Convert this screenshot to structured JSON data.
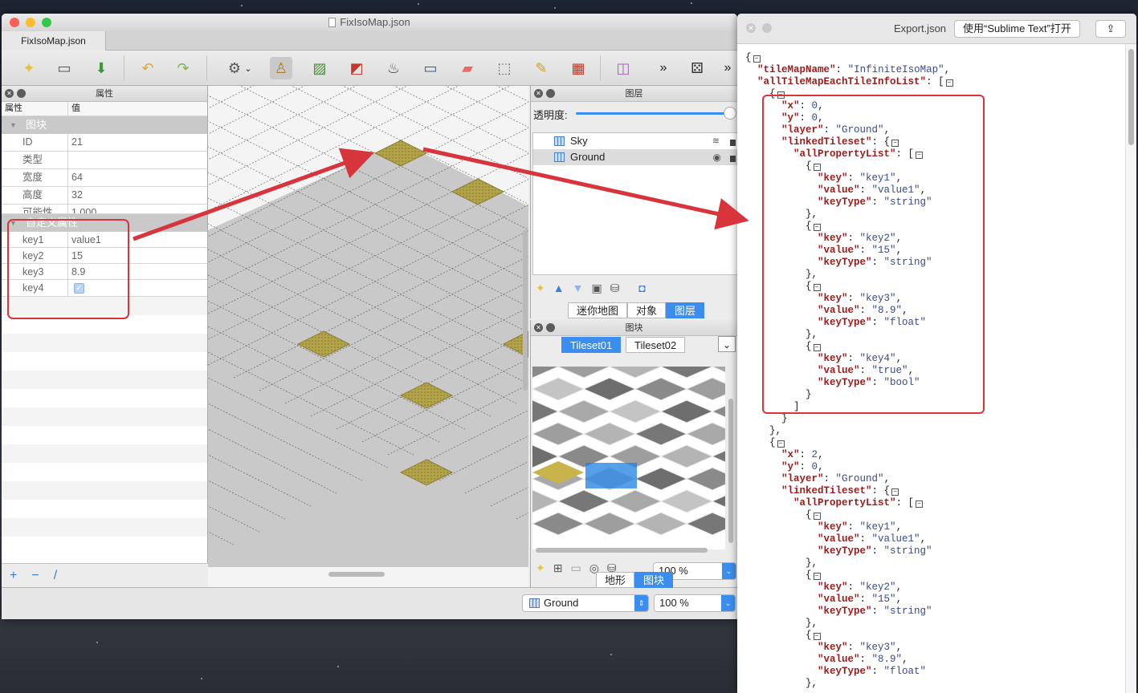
{
  "tiled": {
    "window_title": "FixIsoMap.json",
    "tab_label": "FixIsoMap.json",
    "properties_panel": {
      "title": "属性",
      "col_property": "属性",
      "col_value": "值",
      "group_tile": "图块",
      "rows": [
        {
          "key": "ID",
          "value": "21"
        },
        {
          "key": "类型",
          "value": ""
        },
        {
          "key": "宽度",
          "value": "64"
        },
        {
          "key": "高度",
          "value": "32"
        },
        {
          "key": "可能性",
          "value": "1.000"
        }
      ],
      "group_custom": "自定义属性",
      "custom_rows": [
        {
          "key": "key1",
          "value": "value1"
        },
        {
          "key": "key2",
          "value": "15"
        },
        {
          "key": "key3",
          "value": "8.9"
        },
        {
          "key": "key4",
          "value": "true"
        }
      ],
      "footer_buttons": [
        "+",
        "−",
        "/"
      ]
    },
    "layers_panel": {
      "title": "图层",
      "opacity_label": "透明度:",
      "layers": [
        {
          "name": "Sky"
        },
        {
          "name": "Ground"
        }
      ],
      "tabs": [
        "迷你地图",
        "对象",
        "图层"
      ],
      "active_tab": "图层"
    },
    "tileset_panel": {
      "title": "图块",
      "tabs": [
        "Tileset01",
        "Tileset02"
      ],
      "active_tab": "Tileset01",
      "zoom": "100 %",
      "bottom_tabs": [
        "地形",
        "图块"
      ],
      "active_bottom_tab": "图块"
    },
    "status": {
      "layer_select": "Ground",
      "zoom": "100 %"
    }
  },
  "export": {
    "title": "Export.json",
    "open_button": "使用“Sublime Text”打开",
    "json_lines": [
      "{",
      "  \"tileMapName\": \"InfiniteIsoMap\",",
      "  \"allTileMapEachTileInfoList\": [",
      "    {",
      "      \"x\": 0,",
      "      \"y\": 0,",
      "      \"layer\": \"Ground\",",
      "      \"linkedTileset\": {",
      "        \"allPropertyList\": [",
      "          {",
      "            \"key\": \"key1\",",
      "            \"value\": \"value1\",",
      "            \"keyType\": \"string\"",
      "          },",
      "          {",
      "            \"key\": \"key2\",",
      "            \"value\": \"15\",",
      "            \"keyType\": \"string\"",
      "          },",
      "          {",
      "            \"key\": \"key3\",",
      "            \"value\": \"8.9\",",
      "            \"keyType\": \"float\"",
      "          },",
      "          {",
      "            \"key\": \"key4\",",
      "            \"value\": \"true\",",
      "            \"keyType\": \"bool\"",
      "          }",
      "        ]",
      "      }",
      "    },",
      "    {",
      "      \"x\": 2,",
      "      \"y\": 0,",
      "      \"layer\": \"Ground\",",
      "      \"linkedTileset\": {",
      "        \"allPropertyList\": [",
      "          {",
      "            \"key\": \"key1\",",
      "            \"value\": \"value1\",",
      "            \"keyType\": \"string\"",
      "          },",
      "          {",
      "            \"key\": \"key2\",",
      "            \"value\": \"15\",",
      "            \"keyType\": \"string\"",
      "          },",
      "          {",
      "            \"key\": \"key3\",",
      "            \"value\": \"8.9\",",
      "            \"keyType\": \"float\"",
      "          },"
    ]
  },
  "colors": {
    "accent": "#3b8ef0",
    "annotation_red": "#d8343c",
    "tile_gold": "#c8b44a"
  }
}
